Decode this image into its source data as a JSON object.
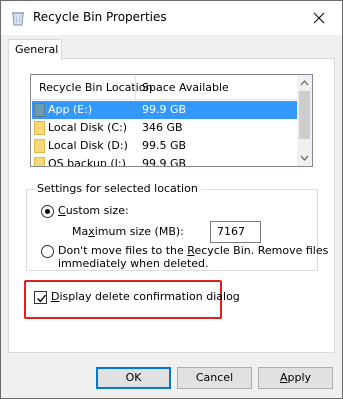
{
  "window": {
    "title": "Recycle Bin Properties"
  },
  "tabs": [
    {
      "label": "General"
    }
  ],
  "list": {
    "columns": [
      "Recycle Bin Location",
      "Space Available"
    ],
    "rows": [
      {
        "location": "App (E:)",
        "space": "99.9 GB",
        "selected": true
      },
      {
        "location": "Local Disk (C:)",
        "space": "346 GB",
        "selected": false
      },
      {
        "location": "Local Disk (D:)",
        "space": "99.5 GB",
        "selected": false
      },
      {
        "location": "OS backup (I:)",
        "space": "99.9 GB",
        "selected": false
      }
    ]
  },
  "settings": {
    "legend": "Settings for selected location",
    "custom_size_label": "Custom size:",
    "custom_size_checked": true,
    "max_size_label": "Maximum size (MB):",
    "max_size_value": "7167",
    "dont_move_line1": "Don't move files to the Recycle Bin. Remove files",
    "dont_move_line2": "immediately when deleted.",
    "dont_move_checked": false
  },
  "confirm": {
    "label": "Display delete confirmation dialog",
    "checked": true,
    "highlight_color": "#e0201e"
  },
  "buttons": {
    "ok": "OK",
    "cancel": "Cancel",
    "apply": "Apply"
  },
  "colors": {
    "selection": "#3399ff",
    "accent": "#0078d7"
  },
  "icons": {
    "title": "recycle-bin-icon",
    "close": "close-icon",
    "folder": "folder-icon"
  }
}
